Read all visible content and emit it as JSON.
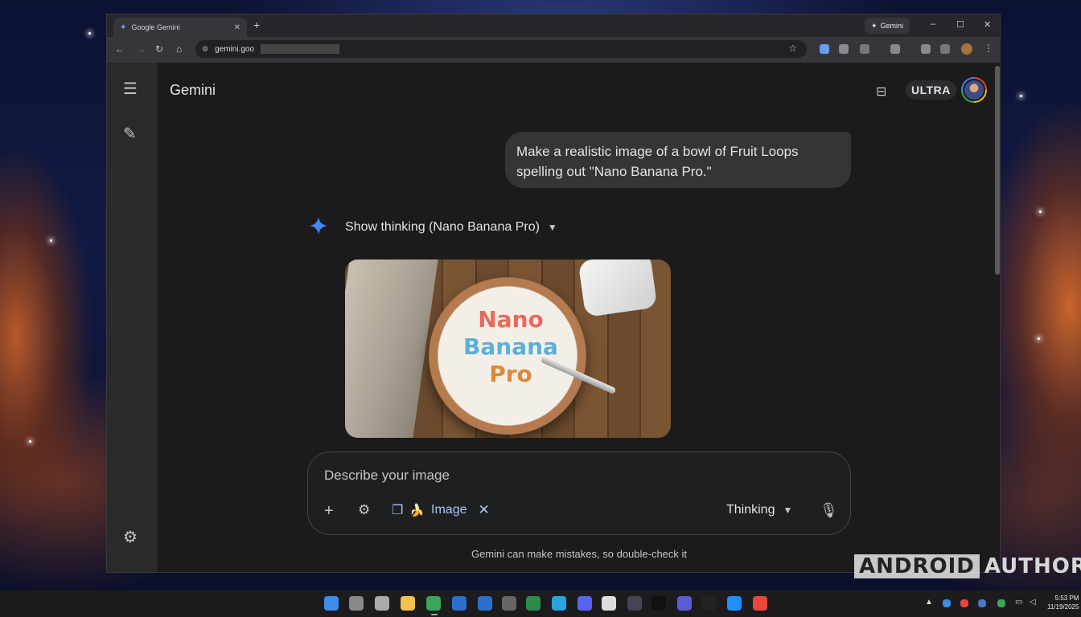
{
  "browser": {
    "tab_title": "Google Gemini",
    "new_tab_glyph": "+",
    "gemini_chip_label": "Gemini",
    "url_text": "gemini.goo",
    "window_controls": [
      "–",
      "☐",
      "✕"
    ]
  },
  "app": {
    "title": "Gemini",
    "plan_badge": "ULTRA"
  },
  "conversation": {
    "user_prompt": "Make a realistic image of a bowl of Fruit Loops spelling out \"Nano Banana Pro.\"",
    "thinking_label": "Show thinking (Nano Banana Pro)",
    "image_text_lines": [
      "Nano",
      "Banana",
      "Pro"
    ]
  },
  "composer": {
    "placeholder": "Describe your image",
    "tool_chip_label": "Image",
    "mode_label": "Thinking",
    "disclaimer": "Gemini can make mistakes, so double-check it"
  },
  "watermark": {
    "boxed": "ANDROID",
    "plain": "AUTHORITY"
  },
  "taskbar": {
    "clock_time": "5:53 PM",
    "clock_date": "11/19/2025"
  },
  "colors": {
    "accent_blue": "#a8c7fa",
    "sparkle": "#4285f4",
    "app_bg": "#1b1b1b",
    "bubble_bg": "#333537"
  },
  "icons": {
    "menu": "hamburger-icon",
    "new_chat": "edit-icon",
    "settings": "gear-icon",
    "sparkle": "sparkle-icon",
    "mic": "microphone-icon"
  }
}
